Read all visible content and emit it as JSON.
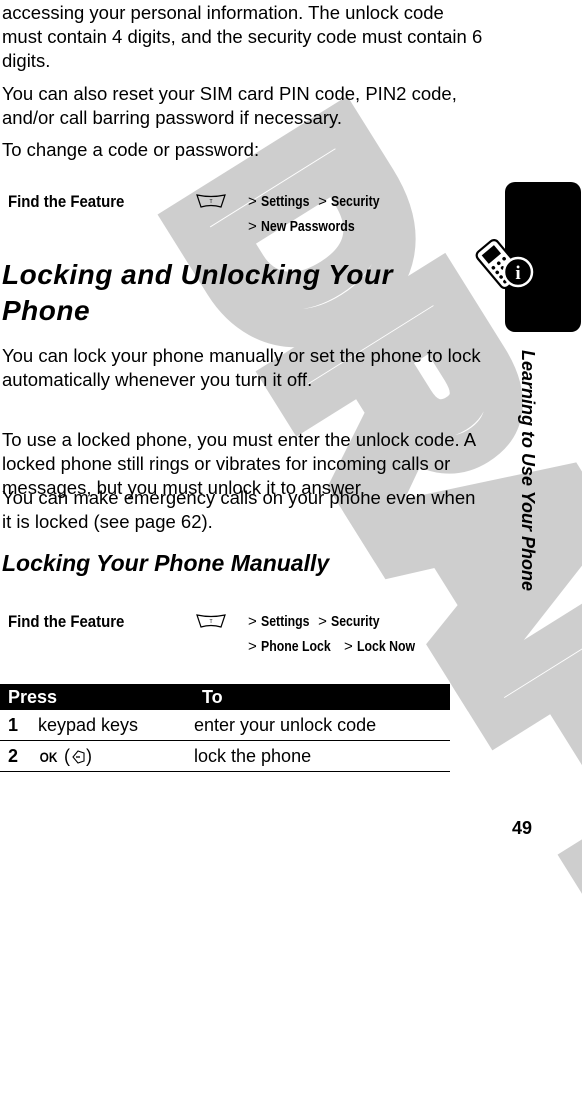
{
  "watermark": "DRAFT",
  "intro": {
    "p1": "accessing your personal information. The unlock code must contain 4 digits, and the security code must contain 6 digits.",
    "p2": "You can also reset your SIM card PIN code, PIN2 code, and/or call barring password if necessary.",
    "p3": "To change a code or password:"
  },
  "feature1": {
    "label": "Find the Feature",
    "icon": "menu-key-icon",
    "path_line1": [
      "Settings",
      "Security"
    ],
    "path_line2": [
      "New Passwords"
    ],
    "separator": ">"
  },
  "section1": {
    "title": "Locking and Unlocking Your Phone",
    "p1": "You can lock your phone manually or set the phone to lock automatically whenever you turn it off.",
    "p2": "To use a locked phone, you must enter the unlock code. A locked phone still rings or vibrates for incoming calls or messages, but you must unlock it to answer.",
    "p3": "You can make emergency calls on your phone even when it is locked (see page 62)."
  },
  "section2": {
    "title": "Locking Your Phone Manually"
  },
  "feature2": {
    "label": "Find the Feature",
    "icon": "menu-key-icon",
    "path_line1": [
      "Settings",
      "Security"
    ],
    "path_line2": [
      "Phone Lock",
      "Lock Now"
    ],
    "separator": ">"
  },
  "table": {
    "headers": [
      "Press",
      "To"
    ],
    "rows": [
      {
        "num": "1",
        "press": "keypad keys",
        "to": "enter your unlock code"
      },
      {
        "num": "2",
        "press_key": "OK",
        "press_icon": "left-soft-key-icon",
        "to": "lock the phone"
      }
    ]
  },
  "side_tab": {
    "icon": "phone-info-icon",
    "section_title": "Learning to Use Your Phone"
  },
  "page_number": "49"
}
